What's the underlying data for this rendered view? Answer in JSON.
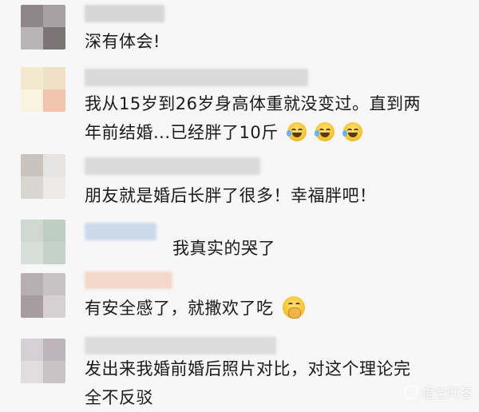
{
  "comments": [
    {
      "text": "深有体会!"
    },
    {
      "lines": [
        "我从15岁到26岁身高体重就没变过。直到两",
        "年前结婚...已经胖了10斤"
      ]
    },
    {
      "text": "朋友就是婚后长胖了很多！幸福胖吧！"
    },
    {
      "text": "我真实的哭了"
    },
    {
      "text": "有安全感了，就撒欢了吃"
    },
    {
      "lines": [
        "发出来我婚前婚后照片对比，对这个理论完",
        "全不反驳"
      ]
    }
  ],
  "watermark": {
    "text": "悟空问答"
  },
  "colors": {
    "background": "#f7f7f7",
    "text": "#1a1a1a",
    "divider": "#e2e2e2"
  },
  "icons": [
    "laughing-crying-emoji",
    "hush-emoji",
    "wukong-logo-icon"
  ]
}
